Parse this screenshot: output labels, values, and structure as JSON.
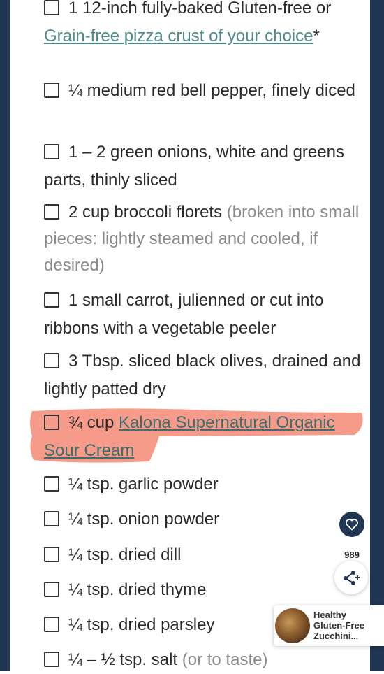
{
  "ingredients": [
    {
      "pre": "1 12-inch fully-baked Gluten-free or ",
      "link": "Grain-free pizza crust of your choice",
      "post": "*",
      "note": ""
    },
    {
      "pre": "¼ medium red bell pepper, finely diced",
      "link": "",
      "post": "",
      "note": ""
    },
    {
      "pre": "1 – 2 green onions, white and greens parts, thinly sliced",
      "link": "",
      "post": "",
      "note": ""
    },
    {
      "pre": "2 cup broccoli florets ",
      "link": "",
      "post": "",
      "note": "(broken into small pieces: lightly steamed and cooled, if desired)"
    },
    {
      "pre": "1 small carrot, julienned or cut into ribbons with a vegetable peeler",
      "link": "",
      "post": "",
      "note": ""
    },
    {
      "pre": "3 Tbsp. sliced black olives, drained and lightly patted dry",
      "link": "",
      "post": "",
      "note": ""
    },
    {
      "pre": "¾ cup ",
      "link": "Kalona Supernatural Organic Sour Cream",
      "post": "",
      "note": ""
    },
    {
      "pre": "¼ tsp. garlic powder",
      "link": "",
      "post": "",
      "note": ""
    },
    {
      "pre": "¼ tsp. onion powder",
      "link": "",
      "post": "",
      "note": ""
    },
    {
      "pre": "¼ tsp. dried dill",
      "link": "",
      "post": "",
      "note": ""
    },
    {
      "pre": "¼ tsp. dried thyme",
      "link": "",
      "post": "",
      "note": ""
    },
    {
      "pre": "¼ tsp. dried parsley",
      "link": "",
      "post": "",
      "note": ""
    },
    {
      "pre": "¼ – ½ tsp. salt ",
      "link": "",
      "post": "",
      "note": "(or to taste)"
    }
  ],
  "social": {
    "share_count": "989",
    "heart_icon": "heart-icon",
    "share_icon": "share-icon"
  },
  "promo": {
    "title": "Healthy Gluten-Free Zucchini..."
  },
  "colors": {
    "frame": "#1f3550",
    "link": "#4f8a8b",
    "highlight": "#f48a74"
  }
}
